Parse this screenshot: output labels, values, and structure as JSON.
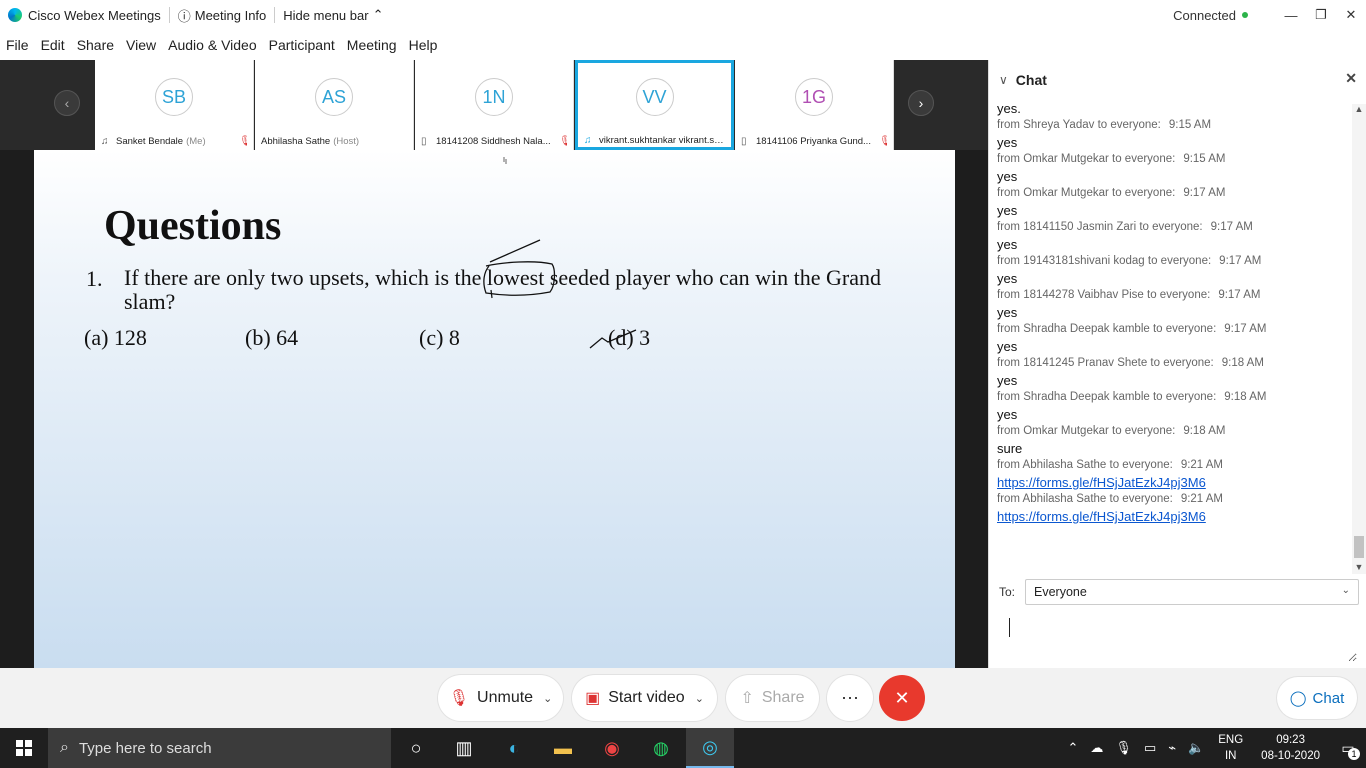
{
  "titlebar": {
    "app_name": "Cisco Webex Meetings",
    "meeting_info": "Meeting Info",
    "hide_menu": "Hide menu bar",
    "status": "Connected"
  },
  "menu": [
    "File",
    "Edit",
    "Share",
    "View",
    "Audio & Video",
    "Participant",
    "Meeting",
    "Help"
  ],
  "participants": [
    {
      "initials": "SB",
      "name": "Sanket Bendale",
      "role": "(Me)"
    },
    {
      "initials": "AS",
      "name": "Abhilasha Sathe",
      "role": "(Host)"
    },
    {
      "initials": "1N",
      "name": "18141208 Siddhesh Nala...",
      "role": ""
    },
    {
      "initials": "VV",
      "name": "vikrant.sukhtankar vikrant.sukhta...",
      "role": ""
    },
    {
      "initials": "1G",
      "name": "18141106 Priyanka Gund...",
      "role": ""
    }
  ],
  "slide": {
    "title": "Questions",
    "question_number": "1.",
    "question_before": "If there are only two upsets, which is the",
    "question_emph": "lowest",
    "question_after": "seeded player who can win the Grand slam?",
    "options": [
      "(a)  128",
      "(b) 64",
      "(c) 8",
      "(d) 3"
    ]
  },
  "chat": {
    "title": "Chat",
    "messages": [
      {
        "text": "yes.",
        "from": "from Shreya Yadav to everyone:",
        "time": "9:15 AM"
      },
      {
        "text": "yes",
        "from": "from Omkar Mutgekar to everyone:",
        "time": "9:15 AM"
      },
      {
        "text": "yes",
        "from": "from Omkar Mutgekar to everyone:",
        "time": "9:17 AM"
      },
      {
        "text": "yes",
        "from": "from 18141150 Jasmin Zari to everyone:",
        "time": "9:17 AM"
      },
      {
        "text": "yes",
        "from": "from 19143181shivani kodag to everyone:",
        "time": "9:17 AM"
      },
      {
        "text": "yes",
        "from": "from 18144278 Vaibhav Pise to everyone:",
        "time": "9:17 AM"
      },
      {
        "text": "yes",
        "from": "from Shradha Deepak kamble to everyone:",
        "time": "9:17 AM"
      },
      {
        "text": "yes",
        "from": "from 18141245 Pranav Shete to everyone:",
        "time": "9:18 AM"
      },
      {
        "text": "yes",
        "from": "from Shradha Deepak kamble to everyone:",
        "time": "9:18 AM"
      },
      {
        "text": "yes",
        "from": "from Omkar Mutgekar to everyone:",
        "time": "9:18 AM"
      },
      {
        "text": "sure",
        "from": "from Abhilasha Sathe to everyone:",
        "time": "9:21 AM"
      },
      {
        "link": "https://forms.gle/fHSjJatEzkJ4pj3M6",
        "from": "from Abhilasha Sathe to everyone:",
        "time": "9:21 AM"
      },
      {
        "link": "https://forms.gle/fHSjJatEzkJ4pj3M6"
      }
    ],
    "to_label": "To:",
    "to_value": "Everyone"
  },
  "controls": {
    "unmute": "Unmute",
    "start_video": "Start video",
    "share": "Share",
    "chat": "Chat"
  },
  "taskbar": {
    "search_placeholder": "Type here to search",
    "lang1": "ENG",
    "lang2": "IN",
    "time": "09:23",
    "date": "08-10-2020",
    "notifications": "1"
  },
  "colors": {
    "accent": "#1aa7e0",
    "leave": "#e8392d",
    "mute": "#d33333",
    "link": "#0b57d0"
  }
}
